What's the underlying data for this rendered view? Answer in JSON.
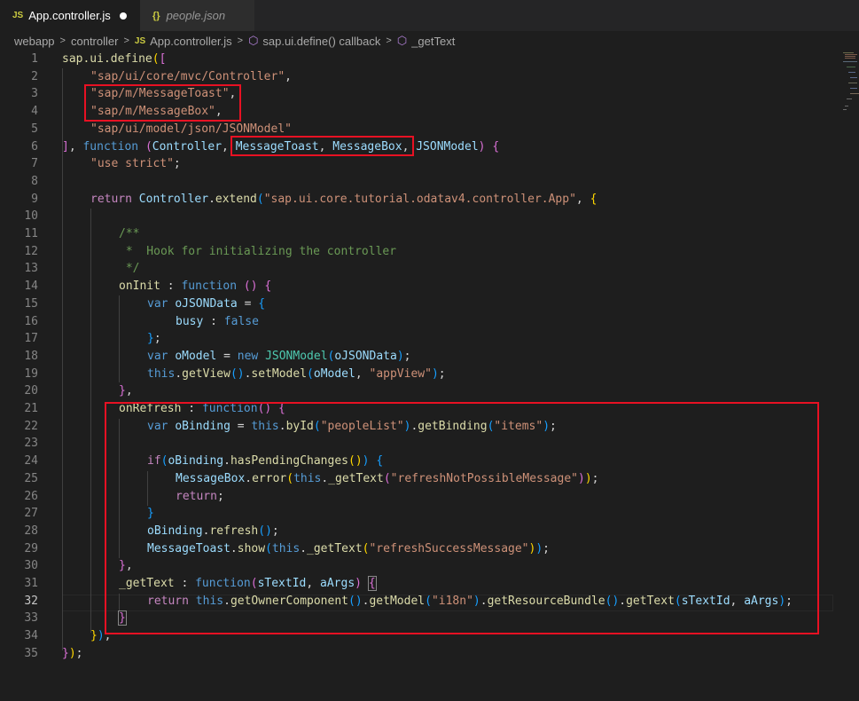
{
  "tabs": [
    {
      "icon": "JS",
      "label": "App.controller.js",
      "active": true,
      "dirty": true
    },
    {
      "icon": "{}",
      "label": "people.json",
      "active": false
    }
  ],
  "breadcrumb": [
    "webapp",
    "controller",
    "App.controller.js",
    "sap.ui.define() callback",
    "_getText"
  ],
  "editor": {
    "current_line": 32,
    "line_numbers": [
      "1",
      "2",
      "3",
      "4",
      "5",
      "6",
      "7",
      "8",
      "9",
      "10",
      "11",
      "12",
      "13",
      "14",
      "15",
      "16",
      "17",
      "18",
      "19",
      "20",
      "21",
      "22",
      "23",
      "24",
      "25",
      "26",
      "27",
      "28",
      "29",
      "30",
      "31",
      "32",
      "33",
      "34",
      "35"
    ]
  },
  "colors": {
    "background": "#1e1e1e",
    "keyword": "#569cd6",
    "control": "#c586c0",
    "string": "#ce9178",
    "function": "#dcdcaa",
    "variable": "#9cdcfe",
    "class": "#4ec9b0",
    "comment": "#6a9955",
    "annotation": "#e81123"
  },
  "code": {
    "l1": {
      "t1": "sap.ui.define",
      "t2": "(",
      "t3": "["
    },
    "l2": {
      "t1": "\"sap/ui/core/mvc/Controller\"",
      "t2": ","
    },
    "l3": {
      "t1": "\"sap/m/MessageToast\"",
      "t2": ","
    },
    "l4": {
      "t1": "\"sap/m/MessageBox\"",
      "t2": ","
    },
    "l5": {
      "t1": "\"sap/ui/model/json/JSONModel\""
    },
    "l6": {
      "t1": "]",
      "t2": ", ",
      "t3": "function",
      "t4": " ",
      "t5": "(",
      "t6": "Controller",
      "t7": ", ",
      "t8": "MessageToast",
      "t9": ", ",
      "t10": "MessageBox",
      "t11": ", ",
      "t12": "JSONModel",
      "t13": ") ",
      "t14": "{"
    },
    "l7": {
      "t1": "\"use strict\"",
      "t2": ";"
    },
    "l9": {
      "t1": "return",
      "t2": " ",
      "t3": "Controller",
      "t4": ".",
      "t5": "extend",
      "t6": "(",
      "t7": "\"sap.ui.core.tutorial.odatav4.controller.App\"",
      "t8": ", ",
      "t9": "{"
    },
    "l11": {
      "t1": "/**"
    },
    "l12": {
      "t1": " *  Hook for initializing the controller"
    },
    "l13": {
      "t1": " */"
    },
    "l14": {
      "t1": "onInit",
      "t2": " : ",
      "t3": "function",
      "t4": " ",
      "t5": "()",
      "t6": " ",
      "t7": "{"
    },
    "l15": {
      "t1": "var",
      "t2": " ",
      "t3": "oJSONData",
      "t4": " = ",
      "t5": "{"
    },
    "l16": {
      "t1": "busy",
      "t2": " : ",
      "t3": "false"
    },
    "l17": {
      "t1": "}",
      "t2": ";"
    },
    "l18": {
      "t1": "var",
      "t2": " ",
      "t3": "oModel",
      "t4": " = ",
      "t5": "new",
      "t6": " ",
      "t7": "JSONModel",
      "t8": "(",
      "t9": "oJSONData",
      "t10": ")",
      "t11": ";"
    },
    "l19": {
      "t1": "this",
      "t2": ".",
      "t3": "getView",
      "t4": "()",
      "t5": ".",
      "t6": "setModel",
      "t7": "(",
      "t8": "oModel",
      "t9": ", ",
      "t10": "\"appView\"",
      "t11": ")",
      "t12": ";"
    },
    "l20": {
      "t1": "}",
      "t2": ","
    },
    "l21": {
      "t1": "onRefresh",
      "t2": " : ",
      "t3": "function",
      "t4": "()",
      "t5": " ",
      "t6": "{"
    },
    "l22": {
      "t1": "var",
      "t2": " ",
      "t3": "oBinding",
      "t4": " = ",
      "t5": "this",
      "t6": ".",
      "t7": "byId",
      "t8": "(",
      "t9": "\"peopleList\"",
      "t10": ")",
      "t11": ".",
      "t12": "getBinding",
      "t13": "(",
      "t14": "\"items\"",
      "t15": ")",
      "t16": ";"
    },
    "l24": {
      "t1": "if",
      "t2": "(",
      "t3": "oBinding",
      "t4": ".",
      "t5": "hasPendingChanges",
      "t6": "()",
      "t7": ")",
      "t8": " ",
      "t9": "{"
    },
    "l25": {
      "t1": "MessageBox",
      "t2": ".",
      "t3": "error",
      "t4": "(",
      "t5": "this",
      "t6": ".",
      "t7": "_getText",
      "t8": "(",
      "t9": "\"refreshNotPossibleMessage\"",
      "t10": ")",
      "t11": ")",
      "t12": ";"
    },
    "l26": {
      "t1": "return",
      "t2": ";"
    },
    "l27": {
      "t1": "}"
    },
    "l28": {
      "t1": "oBinding",
      "t2": ".",
      "t3": "refresh",
      "t4": "()",
      "t5": ";"
    },
    "l29": {
      "t1": "MessageToast",
      "t2": ".",
      "t3": "show",
      "t4": "(",
      "t5": "this",
      "t6": ".",
      "t7": "_getText",
      "t8": "(",
      "t9": "\"refreshSuccessMessage\"",
      "t10": ")",
      "t11": ")",
      "t12": ";"
    },
    "l30": {
      "t1": "}",
      "t2": ","
    },
    "l31": {
      "t1": "_getText",
      "t2": " : ",
      "t3": "function",
      "t4": "(",
      "t5": "sTextId",
      "t6": ", ",
      "t7": "aArgs",
      "t8": ")",
      "t9": " ",
      "t10": "{"
    },
    "l32": {
      "t1": "return",
      "t2": " ",
      "t3": "this",
      "t4": ".",
      "t5": "getOwnerComponent",
      "t6": "()",
      "t7": ".",
      "t8": "getModel",
      "t9": "(",
      "t10": "\"i18n\"",
      "t11": ")",
      "t12": ".",
      "t13": "getResourceBundle",
      "t14": "()",
      "t15": ".",
      "t16": "getText",
      "t17": "(",
      "t18": "sTextId",
      "t19": ", ",
      "t20": "aArgs",
      "t21": ")",
      "t22": ";"
    },
    "l33": {
      "t1": "}"
    },
    "l34": {
      "t1": "}",
      "t2": ")",
      "t3": ";"
    },
    "l35": {
      "t1": "}",
      "t2": ")",
      "t3": ";"
    }
  }
}
